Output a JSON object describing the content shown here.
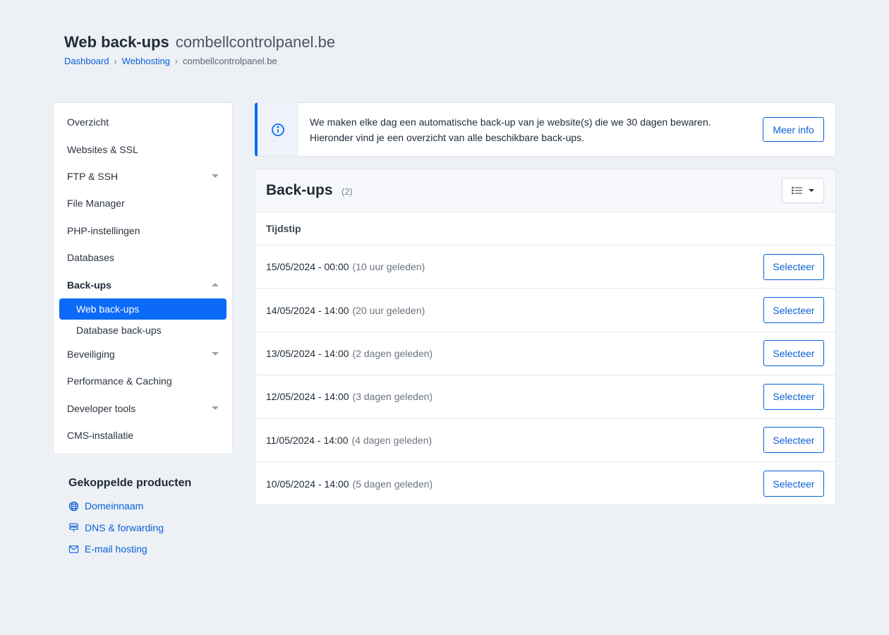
{
  "header": {
    "title": "Web back-ups",
    "domain": "combellcontrolpanel.be",
    "breadcrumb": [
      {
        "label": "Dashboard"
      },
      {
        "label": "Webhosting"
      },
      {
        "label": "combellcontrolpanel.be"
      }
    ],
    "breadcrumb_separator": "›"
  },
  "sidebar": {
    "items": [
      {
        "label": "Overzicht"
      },
      {
        "label": "Websites & SSL"
      },
      {
        "label": "FTP & SSH"
      },
      {
        "label": "File Manager"
      },
      {
        "label": "PHP-instellingen"
      },
      {
        "label": "Databases"
      },
      {
        "label": "Back-ups"
      },
      {
        "label": "Web back-ups"
      },
      {
        "label": "Database back-ups"
      },
      {
        "label": "Beveiliging"
      },
      {
        "label": "Performance & Caching"
      },
      {
        "label": "Developer tools"
      },
      {
        "label": "CMS-installatie"
      }
    ]
  },
  "linked_products": {
    "title": "Gekoppelde producten",
    "items": [
      {
        "label": "Domeinnaam",
        "icon": "globe-icon"
      },
      {
        "label": "DNS & forwarding",
        "icon": "signpost-icon"
      },
      {
        "label": "E-mail hosting",
        "icon": "envelope-icon"
      }
    ]
  },
  "info": {
    "line1": "We maken elke dag een automatische back-up van je website(s) die we 30 dagen bewaren.",
    "line2": "Hieronder vind je een overzicht van alle beschikbare back-ups.",
    "button": "Meer info"
  },
  "backups": {
    "title": "Back-ups",
    "count": "(2)",
    "column": "Tijdstip",
    "select_label": "Selecteer",
    "rows": [
      {
        "time": "15/05/2024 - 00:00",
        "ago": "(10 uur geleden)"
      },
      {
        "time": "14/05/2024 - 14:00",
        "ago": "(20 uur geleden)"
      },
      {
        "time": "13/05/2024 - 14:00",
        "ago": "(2 dagen geleden)"
      },
      {
        "time": "12/05/2024 - 14:00",
        "ago": "(3 dagen geleden)"
      },
      {
        "time": "11/05/2024 - 14:00",
        "ago": "(4 dagen geleden)"
      },
      {
        "time": "10/05/2024 - 14:00",
        "ago": "(5 dagen geleden)"
      }
    ]
  },
  "colors": {
    "accent": "#0b6af7",
    "link": "#0a5fd6",
    "background": "#edf1f5"
  }
}
